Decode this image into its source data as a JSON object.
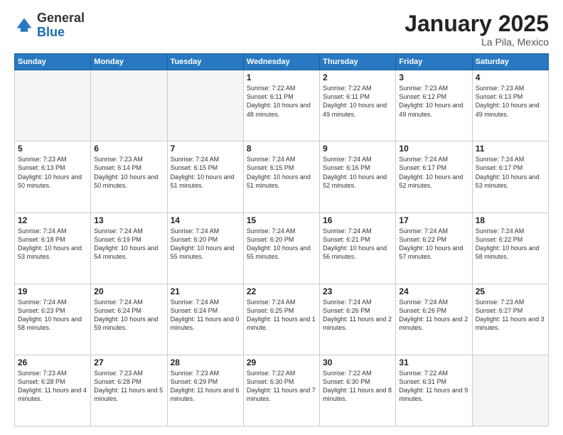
{
  "logo": {
    "general": "General",
    "blue": "Blue"
  },
  "header": {
    "month": "January 2025",
    "location": "La Pila, Mexico"
  },
  "days_of_week": [
    "Sunday",
    "Monday",
    "Tuesday",
    "Wednesday",
    "Thursday",
    "Friday",
    "Saturday"
  ],
  "weeks": [
    [
      {
        "day": "",
        "empty": true
      },
      {
        "day": "",
        "empty": true
      },
      {
        "day": "",
        "empty": true
      },
      {
        "day": "1",
        "sunrise": "7:22 AM",
        "sunset": "6:11 PM",
        "daylight": "10 hours and 48 minutes."
      },
      {
        "day": "2",
        "sunrise": "7:22 AM",
        "sunset": "6:11 PM",
        "daylight": "10 hours and 49 minutes."
      },
      {
        "day": "3",
        "sunrise": "7:23 AM",
        "sunset": "6:12 PM",
        "daylight": "10 hours and 49 minutes."
      },
      {
        "day": "4",
        "sunrise": "7:23 AM",
        "sunset": "6:13 PM",
        "daylight": "10 hours and 49 minutes."
      }
    ],
    [
      {
        "day": "5",
        "sunrise": "7:23 AM",
        "sunset": "6:13 PM",
        "daylight": "10 hours and 50 minutes."
      },
      {
        "day": "6",
        "sunrise": "7:23 AM",
        "sunset": "6:14 PM",
        "daylight": "10 hours and 50 minutes."
      },
      {
        "day": "7",
        "sunrise": "7:24 AM",
        "sunset": "6:15 PM",
        "daylight": "10 hours and 51 minutes."
      },
      {
        "day": "8",
        "sunrise": "7:24 AM",
        "sunset": "6:15 PM",
        "daylight": "10 hours and 51 minutes."
      },
      {
        "day": "9",
        "sunrise": "7:24 AM",
        "sunset": "6:16 PM",
        "daylight": "10 hours and 52 minutes."
      },
      {
        "day": "10",
        "sunrise": "7:24 AM",
        "sunset": "6:17 PM",
        "daylight": "10 hours and 52 minutes."
      },
      {
        "day": "11",
        "sunrise": "7:24 AM",
        "sunset": "6:17 PM",
        "daylight": "10 hours and 53 minutes."
      }
    ],
    [
      {
        "day": "12",
        "sunrise": "7:24 AM",
        "sunset": "6:18 PM",
        "daylight": "10 hours and 53 minutes."
      },
      {
        "day": "13",
        "sunrise": "7:24 AM",
        "sunset": "6:19 PM",
        "daylight": "10 hours and 54 minutes."
      },
      {
        "day": "14",
        "sunrise": "7:24 AM",
        "sunset": "6:20 PM",
        "daylight": "10 hours and 55 minutes."
      },
      {
        "day": "15",
        "sunrise": "7:24 AM",
        "sunset": "6:20 PM",
        "daylight": "10 hours and 55 minutes."
      },
      {
        "day": "16",
        "sunrise": "7:24 AM",
        "sunset": "6:21 PM",
        "daylight": "10 hours and 56 minutes."
      },
      {
        "day": "17",
        "sunrise": "7:24 AM",
        "sunset": "6:22 PM",
        "daylight": "10 hours and 57 minutes."
      },
      {
        "day": "18",
        "sunrise": "7:24 AM",
        "sunset": "6:22 PM",
        "daylight": "10 hours and 58 minutes."
      }
    ],
    [
      {
        "day": "19",
        "sunrise": "7:24 AM",
        "sunset": "6:23 PM",
        "daylight": "10 hours and 58 minutes."
      },
      {
        "day": "20",
        "sunrise": "7:24 AM",
        "sunset": "6:24 PM",
        "daylight": "10 hours and 59 minutes."
      },
      {
        "day": "21",
        "sunrise": "7:24 AM",
        "sunset": "6:24 PM",
        "daylight": "11 hours and 0 minutes."
      },
      {
        "day": "22",
        "sunrise": "7:24 AM",
        "sunset": "6:25 PM",
        "daylight": "11 hours and 1 minute."
      },
      {
        "day": "23",
        "sunrise": "7:24 AM",
        "sunset": "6:26 PM",
        "daylight": "11 hours and 2 minutes."
      },
      {
        "day": "24",
        "sunrise": "7:24 AM",
        "sunset": "6:26 PM",
        "daylight": "11 hours and 2 minutes."
      },
      {
        "day": "25",
        "sunrise": "7:23 AM",
        "sunset": "6:27 PM",
        "daylight": "11 hours and 3 minutes."
      }
    ],
    [
      {
        "day": "26",
        "sunrise": "7:23 AM",
        "sunset": "6:28 PM",
        "daylight": "11 hours and 4 minutes."
      },
      {
        "day": "27",
        "sunrise": "7:23 AM",
        "sunset": "6:28 PM",
        "daylight": "11 hours and 5 minutes."
      },
      {
        "day": "28",
        "sunrise": "7:23 AM",
        "sunset": "6:29 PM",
        "daylight": "11 hours and 6 minutes."
      },
      {
        "day": "29",
        "sunrise": "7:22 AM",
        "sunset": "6:30 PM",
        "daylight": "11 hours and 7 minutes."
      },
      {
        "day": "30",
        "sunrise": "7:22 AM",
        "sunset": "6:30 PM",
        "daylight": "11 hours and 8 minutes."
      },
      {
        "day": "31",
        "sunrise": "7:22 AM",
        "sunset": "6:31 PM",
        "daylight": "11 hours and 9 minutes."
      },
      {
        "day": "",
        "empty": true
      }
    ]
  ],
  "labels": {
    "sunrise": "Sunrise:",
    "sunset": "Sunset:",
    "daylight": "Daylight:"
  }
}
